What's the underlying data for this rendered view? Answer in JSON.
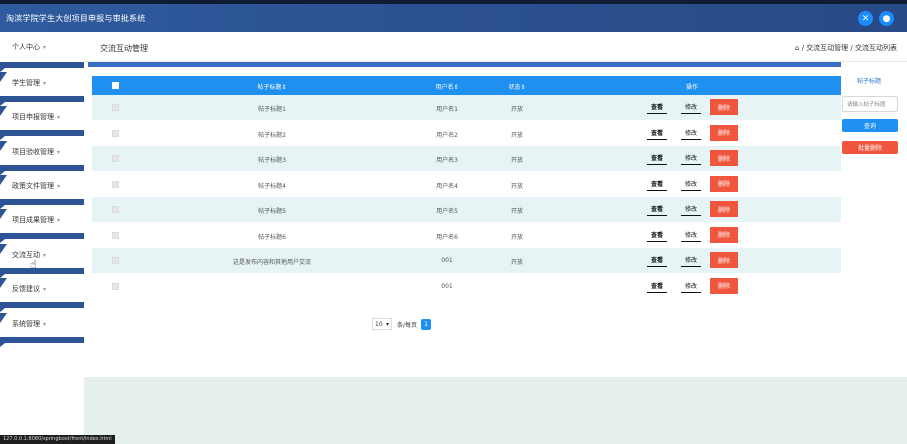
{
  "header": {
    "title": "淘滨学院学生大创项目申报与审批系统",
    "icons": [
      "expand-icon",
      "user-icon"
    ]
  },
  "sidebar": {
    "top_item": "个人中心",
    "items": [
      {
        "label": "学生管理"
      },
      {
        "label": "项目申报管理"
      },
      {
        "label": "项目验收管理"
      },
      {
        "label": "政策文件管理"
      },
      {
        "label": "项目成果管理"
      },
      {
        "label": "交流互动"
      },
      {
        "label": "反馈建议"
      },
      {
        "label": "系统管理"
      }
    ]
  },
  "page": {
    "title": "交流互动管理",
    "breadcrumb": "交流互动管理 / 交流互动列表"
  },
  "table": {
    "headers": {
      "title": "帖子标题",
      "user": "用户名",
      "status": "状态",
      "actions": "操作"
    },
    "rows": [
      {
        "title": "帖子标题1",
        "user": "用户名1",
        "status": "开放"
      },
      {
        "title": "帖子标题2",
        "user": "用户名2",
        "status": "开放"
      },
      {
        "title": "帖子标题3",
        "user": "用户名3",
        "status": "开放"
      },
      {
        "title": "帖子标题4",
        "user": "用户名4",
        "status": "开放"
      },
      {
        "title": "帖子标题5",
        "user": "用户名5",
        "status": "开放"
      },
      {
        "title": "帖子标题6",
        "user": "用户名6",
        "status": "开放"
      },
      {
        "title": "这是发布内容和其他用户交流",
        "user": "001",
        "status": "开放"
      },
      {
        "title": "",
        "user": "001",
        "status": ""
      }
    ],
    "actions": {
      "view": "查看",
      "edit": "修改",
      "delete": "删除"
    }
  },
  "pagination": {
    "page_size": "10",
    "total_label": "条/每页",
    "current_page": "1"
  },
  "search": {
    "label": "帖子标题",
    "placeholder": "请输入帖子标题",
    "search_button": "查询",
    "batch_delete_button": "批量删除"
  },
  "status_bar": {
    "url": "127.0.0.1:8080/springboot/front/index.html"
  }
}
